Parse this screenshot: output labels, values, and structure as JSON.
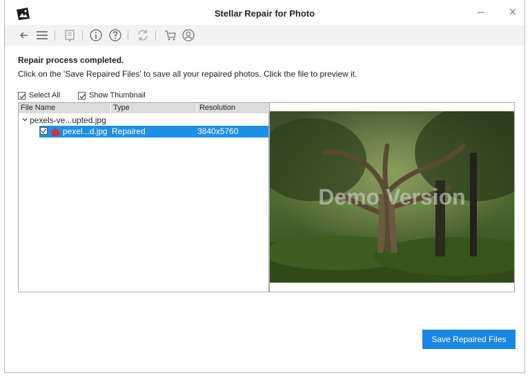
{
  "window": {
    "title": "Stellar Repair for Photo"
  },
  "toolbar": {
    "icons": [
      "back-arrow-icon",
      "menu-icon",
      "register-icon",
      "info-icon",
      "help-icon",
      "update-icon",
      "cart-icon",
      "account-icon"
    ]
  },
  "status": {
    "heading": "Repair process completed.",
    "instruction": "Click on the 'Save Repaired Files' to save all your repaired photos. Click the file to preview it."
  },
  "options": {
    "select_all": "Select All",
    "show_thumbnail": "Show Thumbnail"
  },
  "table": {
    "columns": [
      "File Name",
      "Type",
      "Resolution"
    ],
    "parent": "pexels-ve...upted.jpg",
    "rows": [
      {
        "name": "pexel...d.jpg",
        "type": "Repaired",
        "resolution": "3840x5760"
      }
    ]
  },
  "preview": {
    "watermark": "Demo Version"
  },
  "actions": {
    "save_label": "Save Repaired Files"
  },
  "colors": {
    "accent": "#1a86e3",
    "selection": "#1e90e6"
  }
}
